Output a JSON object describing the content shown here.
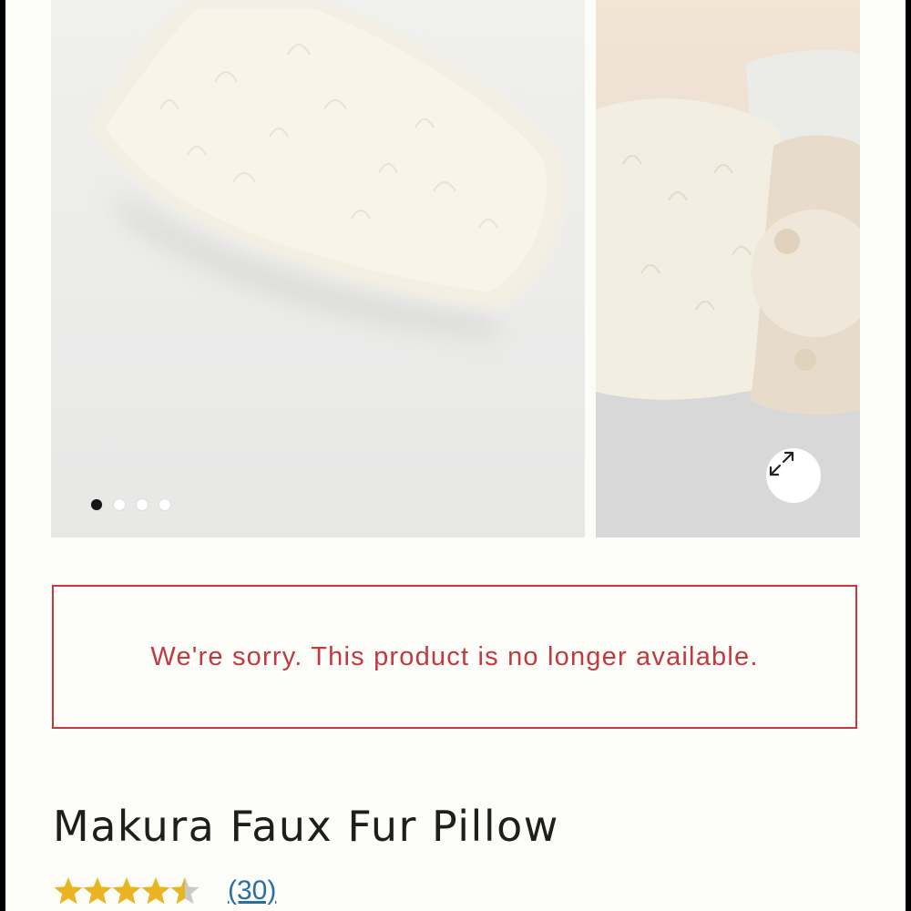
{
  "gallery": {
    "main_image_alt": "Ivory faux fur pillow",
    "side_image_alt": "Faux fur pillow styled on a bed",
    "slide_count": 4,
    "active_slide": 1,
    "expand_icon": "expand-arrows-icon"
  },
  "notice": {
    "message": "We're sorry. This product is no longer available.",
    "color": "#c8363f"
  },
  "product": {
    "title": "Makura Faux Fur Pillow",
    "rating": 4.5,
    "rating_max": 5,
    "review_count_label": "(30)",
    "star_color": "#e8b420"
  }
}
